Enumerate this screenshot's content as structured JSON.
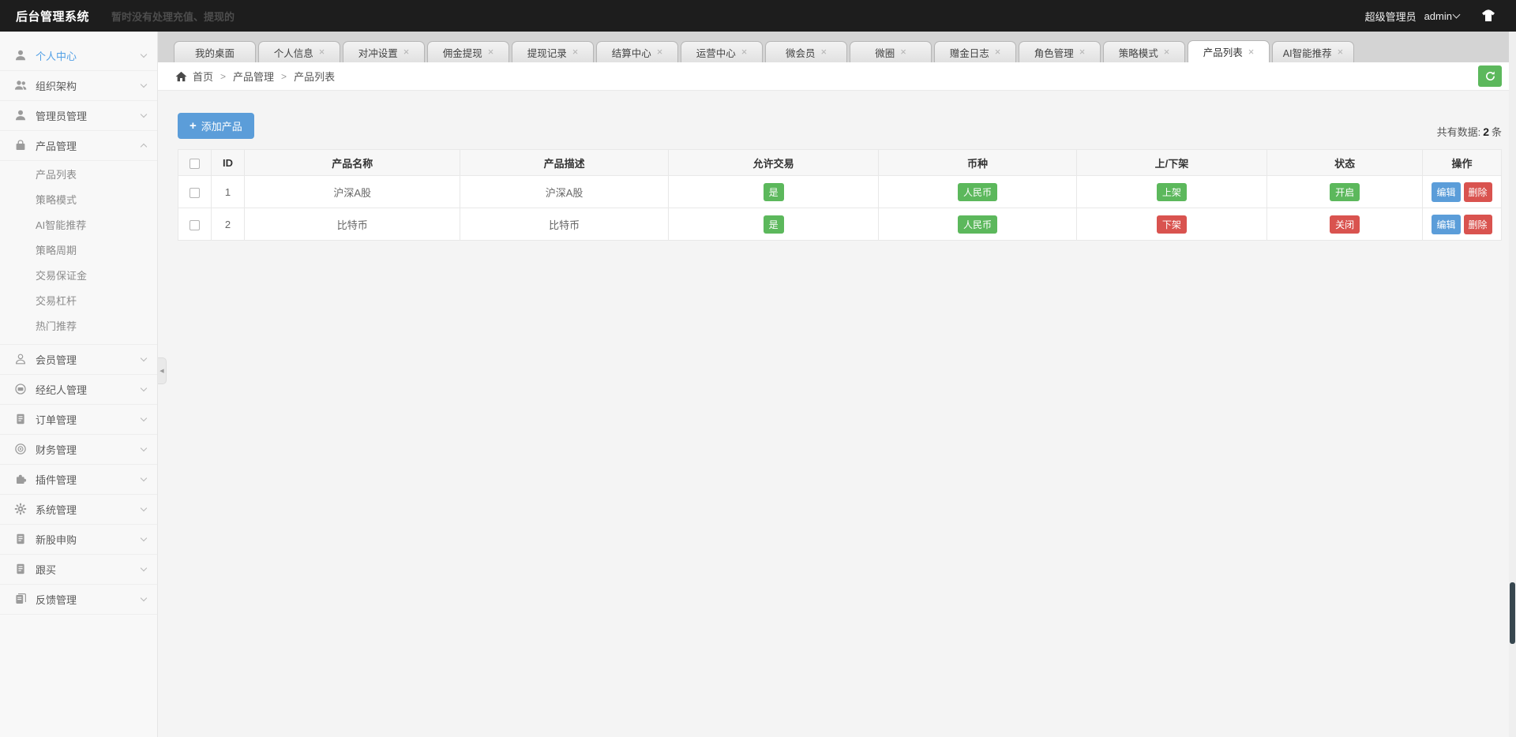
{
  "topbar": {
    "title": "后台管理系统",
    "notice": "暂时没有处理充值、提现的",
    "role": "超级管理员",
    "username": "admin"
  },
  "sidebar": {
    "items": [
      {
        "key": "personal-center",
        "label": "个人中心",
        "icon": "user-icon",
        "highlighted": true
      },
      {
        "key": "organization",
        "label": "组织架构",
        "icon": "users-icon"
      },
      {
        "key": "admin-management",
        "label": "管理员管理",
        "icon": "admin-icon"
      },
      {
        "key": "product-management",
        "label": "产品管理",
        "icon": "bag-icon",
        "expanded": true,
        "children": [
          {
            "key": "product-list",
            "label": "产品列表"
          },
          {
            "key": "strategy-mode",
            "label": "策略模式"
          },
          {
            "key": "ai-recommend",
            "label": "AI智能推荐"
          },
          {
            "key": "strategy-cycle",
            "label": "策略周期"
          },
          {
            "key": "trade-margin",
            "label": "交易保证金"
          },
          {
            "key": "trade-leverage",
            "label": "交易杠杆"
          },
          {
            "key": "hot-recommend",
            "label": "热门推荐"
          }
        ]
      },
      {
        "key": "member-management",
        "label": "会员管理",
        "icon": "member-icon"
      },
      {
        "key": "broker-management",
        "label": "经纪人管理",
        "icon": "broker-icon"
      },
      {
        "key": "order-management",
        "label": "订单管理",
        "icon": "doc-icon"
      },
      {
        "key": "finance-management",
        "label": "财务管理",
        "icon": "finance-icon"
      },
      {
        "key": "plugin-management",
        "label": "插件管理",
        "icon": "plugin-icon"
      },
      {
        "key": "system-management",
        "label": "系统管理",
        "icon": "gear-icon"
      },
      {
        "key": "new-stock",
        "label": "新股申购",
        "icon": "doc-icon"
      },
      {
        "key": "follow-buy",
        "label": "跟买",
        "icon": "doc-icon"
      },
      {
        "key": "feedback-management",
        "label": "反馈管理",
        "icon": "feedback-icon"
      }
    ]
  },
  "tabs": [
    {
      "key": "my-desktop",
      "label": "我的桌面",
      "closable": false
    },
    {
      "key": "personal-info",
      "label": "个人信息",
      "closable": true
    },
    {
      "key": "hedge-settings",
      "label": "对冲设置",
      "closable": true
    },
    {
      "key": "commission-withdraw",
      "label": "佣金提现",
      "closable": true
    },
    {
      "key": "withdraw-records",
      "label": "提现记录",
      "closable": true
    },
    {
      "key": "settlement-center",
      "label": "结算中心",
      "closable": true
    },
    {
      "key": "operation-center",
      "label": "运营中心",
      "closable": true
    },
    {
      "key": "micro-member",
      "label": "微会员",
      "closable": true
    },
    {
      "key": "micro-circle",
      "label": "微圈",
      "closable": true
    },
    {
      "key": "bonus-log",
      "label": "赠金日志",
      "closable": true
    },
    {
      "key": "role-management",
      "label": "角色管理",
      "closable": true
    },
    {
      "key": "strategy-mode",
      "label": "策略模式",
      "closable": true
    },
    {
      "key": "product-list",
      "label": "产品列表",
      "closable": true,
      "active": true
    },
    {
      "key": "ai-recommend",
      "label": "AI智能推荐",
      "closable": true
    }
  ],
  "breadcrumb": {
    "items": [
      "首页",
      "产品管理",
      "产品列表"
    ],
    "separator": ">"
  },
  "toolbar": {
    "add_label": "添加产品",
    "total_prefix": "共有数据:",
    "total_count": "2",
    "total_suffix": "条"
  },
  "table": {
    "columns": [
      "ID",
      "产品名称",
      "产品描述",
      "允许交易",
      "币种",
      "上/下架",
      "状态",
      "操作"
    ],
    "rows": [
      {
        "id": "1",
        "name": "沪深A股",
        "description": "沪深A股",
        "allow_trade": "是",
        "currency": "人民币",
        "shelf": "上架",
        "shelf_color": "green",
        "status": "开启",
        "status_color": "green"
      },
      {
        "id": "2",
        "name": "比特币",
        "description": "比特币",
        "allow_trade": "是",
        "currency": "人民币",
        "shelf": "下架",
        "shelf_color": "red",
        "status": "关闭",
        "status_color": "red"
      }
    ],
    "actions": {
      "edit": "编辑",
      "delete": "删除"
    }
  },
  "colors": {
    "topbar_bg": "#1d1d1d",
    "accent_blue": "#5b9dd9",
    "badge_green": "#5cb85c",
    "badge_red": "#d9534f",
    "refresh_green": "#5cb85c"
  }
}
